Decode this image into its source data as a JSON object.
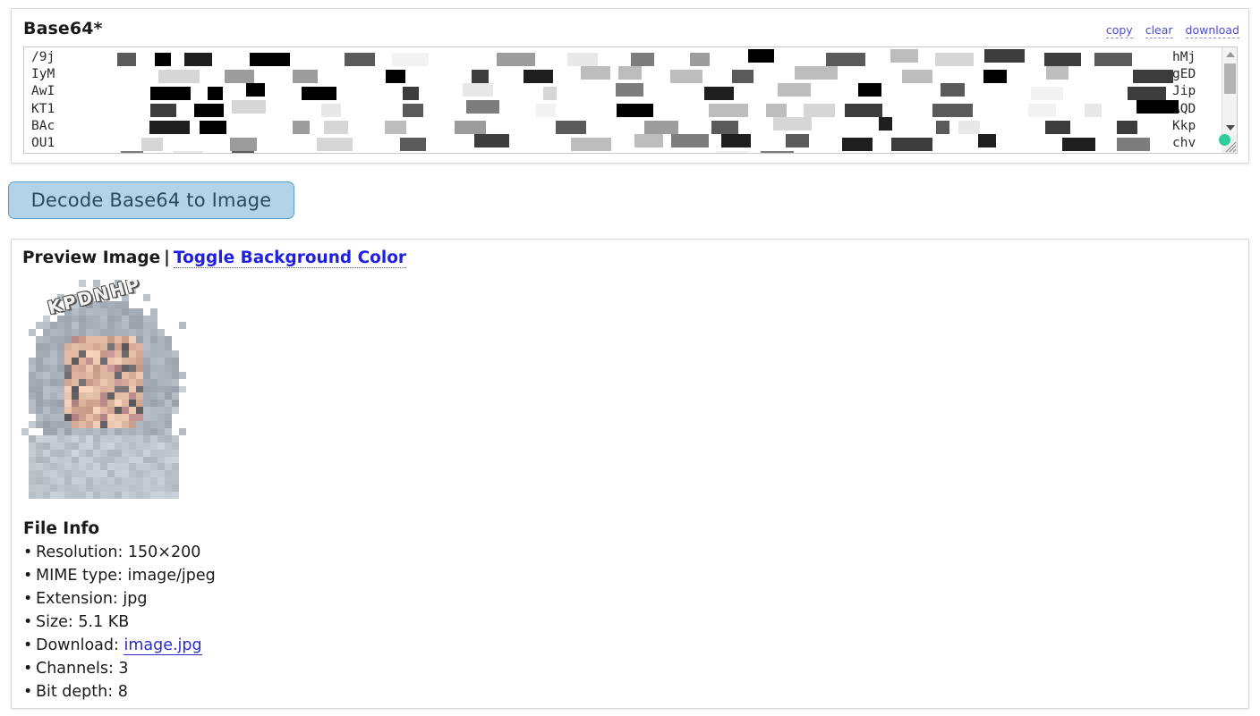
{
  "input_panel": {
    "title": "Base64*",
    "tools": [
      {
        "name": "copy-link",
        "label": "copy"
      },
      {
        "name": "clear-link",
        "label": "clear"
      },
      {
        "name": "download-link",
        "label": "download"
      }
    ],
    "textarea": {
      "left_column": "/9j\nIyM\nAwI\nKT1\nBAc\nOU1",
      "right_column": "hMj\ngED\nJip\nAQD\nKkp\nchv",
      "content_state": "redacted",
      "scrollbar": {
        "up_icon": "triangle-up-icon",
        "down_icon": "triangle-down-icon"
      }
    }
  },
  "decode_button": {
    "label": "Decode Base64 to Image",
    "bg": "#b3d4e8",
    "border": "#5b9bc4",
    "text_color": "#2a4a60"
  },
  "preview_panel": {
    "heading": "Preview Image",
    "separator": "|",
    "toggle_label": "Toggle Background Color",
    "toggle_color": "#2020e0",
    "image": {
      "watermark": "KPDNHP",
      "alt": "pixelated portrait of person in gray hoodie"
    },
    "file_info": {
      "title": "File Info",
      "items": [
        {
          "label": "Resolution",
          "value": "150×200"
        },
        {
          "label": "MIME type",
          "value": "image/jpeg"
        },
        {
          "label": "Extension",
          "value": "jpg"
        },
        {
          "label": "Size",
          "value": "5.1 KB"
        },
        {
          "label": "Download",
          "value": "image.jpg",
          "is_link": true
        },
        {
          "label": "Channels",
          "value": "3"
        },
        {
          "label": "Bit depth",
          "value": "8"
        }
      ],
      "lines": [
        "Resolution: 150×200",
        "MIME type: image/jpeg",
        "Extension: jpg",
        "Size: 5.1 KB",
        "Download: ",
        "Channels: 3",
        "Bit depth: 8"
      ],
      "download_filename": "image.jpg"
    }
  },
  "cursor": {
    "name": "cursor-dot",
    "color": "#2ecc9b"
  }
}
